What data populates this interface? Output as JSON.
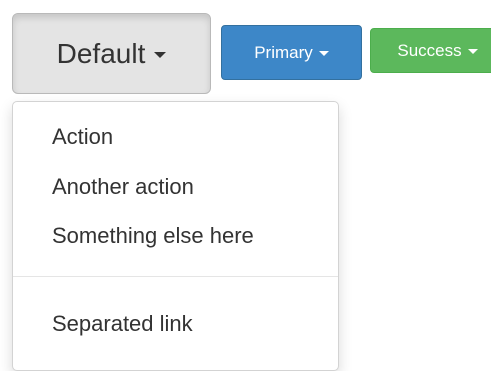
{
  "buttons": {
    "default_label": "Default",
    "primary_label": "Primary",
    "success_label": "Success"
  },
  "dropdown": {
    "items": [
      {
        "label": "Action"
      },
      {
        "label": "Another action"
      },
      {
        "label": "Something else here"
      }
    ],
    "separated_item": {
      "label": "Separated link"
    }
  },
  "colors": {
    "default_active_bg": "#e4e4e4",
    "primary": "#3d87c8",
    "success": "#5cb85c",
    "text": "#333333"
  },
  "icons": {
    "caret": "caret-down-icon"
  }
}
